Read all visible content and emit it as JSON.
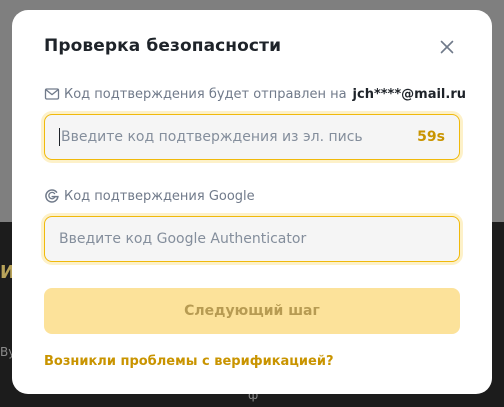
{
  "background": {
    "fragment_a": "И",
    "fragment_b": "Ву",
    "fragment_c": "ф"
  },
  "modal": {
    "title": "Проверка безопасности",
    "close_icon": "close-icon"
  },
  "email_section": {
    "icon": "envelope-icon",
    "label": "Код подтверждения будет отправлен на",
    "email": "jch****@mail.ru",
    "placeholder": "Введите код подтверждения из эл. пись",
    "value": "",
    "timer": "59s"
  },
  "google_section": {
    "icon": "google-icon",
    "label": "Код подтверждения Google",
    "placeholder": "Введите код Google Authenticator",
    "value": ""
  },
  "next_button": {
    "label": "Следующий шаг",
    "enabled": false
  },
  "help_link": {
    "label": "Возникли проблемы с верификацией?"
  },
  "colors": {
    "accent": "#f0b90b",
    "accent_text": "#c99400",
    "button_disabled_bg": "#fce29a",
    "backdrop": "#7f7f7f"
  }
}
